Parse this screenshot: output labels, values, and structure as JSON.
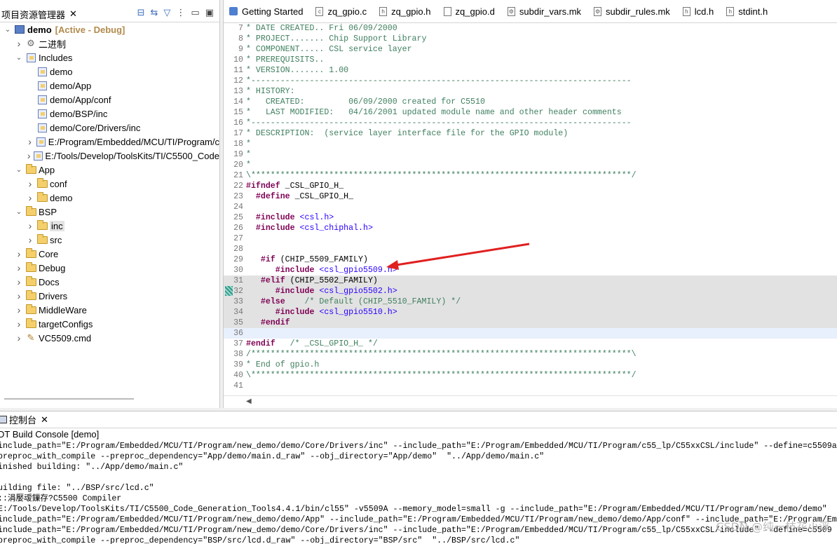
{
  "explorer": {
    "tab_label": "项目资源管理器",
    "close": "✕",
    "tree": [
      {
        "depth": 0,
        "twisty": "open",
        "icon": "project",
        "label": "demo",
        "suffix": "[Active - Debug]",
        "bold": true
      },
      {
        "depth": 1,
        "twisty": "closed",
        "icon": "binaries",
        "label": "二进制"
      },
      {
        "depth": 1,
        "twisty": "open",
        "icon": "includes",
        "label": "Includes"
      },
      {
        "depth": 2,
        "twisty": "none",
        "icon": "incfolder",
        "label": "demo"
      },
      {
        "depth": 2,
        "twisty": "none",
        "icon": "incfolder",
        "label": "demo/App"
      },
      {
        "depth": 2,
        "twisty": "none",
        "icon": "incfolder",
        "label": "demo/App/conf"
      },
      {
        "depth": 2,
        "twisty": "none",
        "icon": "incfolder",
        "label": "demo/BSP/inc"
      },
      {
        "depth": 2,
        "twisty": "none",
        "icon": "incfolder",
        "label": "demo/Core/Drivers/inc"
      },
      {
        "depth": 2,
        "twisty": "closed",
        "icon": "incfolder",
        "label": "E:/Program/Embedded/MCU/TI/Program/c"
      },
      {
        "depth": 2,
        "twisty": "closed",
        "icon": "incfolder",
        "label": "E:/Tools/Develop/ToolsKits/TI/C5500_Code"
      },
      {
        "depth": 1,
        "twisty": "open",
        "icon": "folder",
        "label": "App"
      },
      {
        "depth": 2,
        "twisty": "closed",
        "icon": "folder",
        "label": "conf"
      },
      {
        "depth": 2,
        "twisty": "closed",
        "icon": "folder",
        "label": "demo"
      },
      {
        "depth": 1,
        "twisty": "open",
        "icon": "folder",
        "label": "BSP"
      },
      {
        "depth": 2,
        "twisty": "closed",
        "icon": "folder",
        "label": "inc",
        "selected": true
      },
      {
        "depth": 2,
        "twisty": "closed",
        "icon": "folder",
        "label": "src"
      },
      {
        "depth": 1,
        "twisty": "closed",
        "icon": "folder",
        "label": "Core"
      },
      {
        "depth": 1,
        "twisty": "closed",
        "icon": "folder",
        "label": "Debug"
      },
      {
        "depth": 1,
        "twisty": "closed",
        "icon": "folder",
        "label": "Docs"
      },
      {
        "depth": 1,
        "twisty": "closed",
        "icon": "folder",
        "label": "Drivers"
      },
      {
        "depth": 1,
        "twisty": "closed",
        "icon": "folder",
        "label": "MiddleWare"
      },
      {
        "depth": 1,
        "twisty": "closed",
        "icon": "folder",
        "label": "targetConfigs"
      },
      {
        "depth": 1,
        "twisty": "closed",
        "icon": "cmdfile",
        "label": "VC5509.cmd"
      }
    ]
  },
  "editor": {
    "tabs": [
      {
        "label": "Getting Started",
        "icon": "getting-started"
      },
      {
        "label": "zq_gpio.c",
        "icon": "c-file"
      },
      {
        "label": "zq_gpio.h",
        "icon": "h-file"
      },
      {
        "label": "zq_gpio.d",
        "icon": "d-file"
      },
      {
        "label": "subdir_vars.mk",
        "icon": "mk-file"
      },
      {
        "label": "subdir_rules.mk",
        "icon": "mk-file"
      },
      {
        "label": "lcd.h",
        "icon": "h-file"
      },
      {
        "label": "stdint.h",
        "icon": "h-file"
      }
    ],
    "lines": [
      {
        "n": "7",
        "segs": [
          [
            "cm",
            "* DATE CREATED.. Fri 06/09/2000"
          ]
        ]
      },
      {
        "n": "8",
        "segs": [
          [
            "cm",
            "* PROJECT....... Chip Support Library"
          ]
        ]
      },
      {
        "n": "9",
        "segs": [
          [
            "cm",
            "* COMPONENT..... CSL service layer"
          ]
        ]
      },
      {
        "n": "10",
        "segs": [
          [
            "cm",
            "* PREREQUISITS.."
          ]
        ]
      },
      {
        "n": "11",
        "segs": [
          [
            "cm",
            "* VERSION....... 1.00"
          ]
        ]
      },
      {
        "n": "12",
        "segs": [
          [
            "cm",
            "*------------------------------------------------------------------------------"
          ]
        ]
      },
      {
        "n": "13",
        "segs": [
          [
            "cm",
            "* HISTORY:"
          ]
        ]
      },
      {
        "n": "14",
        "segs": [
          [
            "cm",
            "*   CREATED:         06/09/2000 created for C5510"
          ]
        ]
      },
      {
        "n": "15",
        "segs": [
          [
            "cm",
            "*   LAST MODIFIED:   04/16/2001 updated module name and other header comments"
          ]
        ]
      },
      {
        "n": "16",
        "segs": [
          [
            "cm",
            "*------------------------------------------------------------------------------"
          ]
        ]
      },
      {
        "n": "17",
        "segs": [
          [
            "cm",
            "* DESCRIPTION:  (service layer interface file for the GPIO module)"
          ]
        ]
      },
      {
        "n": "18",
        "segs": [
          [
            "cm",
            "*"
          ]
        ]
      },
      {
        "n": "19",
        "segs": [
          [
            "cm",
            "*"
          ]
        ]
      },
      {
        "n": "20",
        "segs": [
          [
            "cm",
            "*"
          ]
        ]
      },
      {
        "n": "21",
        "segs": [
          [
            "cm",
            "\\******************************************************************************/"
          ]
        ]
      },
      {
        "n": "22",
        "segs": [
          [
            "kw",
            "#ifndef"
          ],
          [
            "plain",
            " _CSL_GPIO_H_"
          ]
        ]
      },
      {
        "n": "23",
        "segs": [
          [
            "kw",
            "  #define"
          ],
          [
            "plain",
            " _CSL_GPIO_H_"
          ]
        ]
      },
      {
        "n": "24",
        "segs": [
          [
            "plain",
            ""
          ]
        ]
      },
      {
        "n": "25",
        "segs": [
          [
            "kw",
            "  #include"
          ],
          [
            "plain",
            " "
          ],
          [
            "st",
            "<csl.h>"
          ]
        ]
      },
      {
        "n": "26",
        "segs": [
          [
            "kw",
            "  #include"
          ],
          [
            "plain",
            " "
          ],
          [
            "st",
            "<csl_chiphal.h>"
          ]
        ]
      },
      {
        "n": "27",
        "segs": [
          [
            "plain",
            ""
          ]
        ]
      },
      {
        "n": "28",
        "segs": [
          [
            "plain",
            ""
          ]
        ]
      },
      {
        "n": "29",
        "segs": [
          [
            "kw",
            "   #if"
          ],
          [
            "plain",
            " (CHIP_5509_FAMILY)"
          ]
        ]
      },
      {
        "n": "30",
        "segs": [
          [
            "kw",
            "      #include"
          ],
          [
            "plain",
            " "
          ],
          [
            "st",
            "<csl_gpio5509.h>"
          ]
        ]
      },
      {
        "n": "31",
        "hl": true,
        "segs": [
          [
            "kw",
            "   #elif"
          ],
          [
            "plain",
            " (CHIP_5502_FAMILY)"
          ]
        ]
      },
      {
        "n": "32",
        "hl": true,
        "segs": [
          [
            "kw",
            "      #include"
          ],
          [
            "plain",
            " "
          ],
          [
            "st",
            "<csl_gpio5502.h>"
          ]
        ]
      },
      {
        "n": "33",
        "hl": true,
        "segs": [
          [
            "kw",
            "   #else"
          ],
          [
            "plain",
            "    "
          ],
          [
            "cm",
            "/* Default (CHIP_5510_FAMILY) */"
          ]
        ]
      },
      {
        "n": "34",
        "hl": true,
        "segs": [
          [
            "kw",
            "      #include"
          ],
          [
            "plain",
            " "
          ],
          [
            "st",
            "<csl_gpio5510.h>"
          ]
        ]
      },
      {
        "n": "35",
        "hl": true,
        "segs": [
          [
            "kw",
            "   #endif"
          ]
        ]
      },
      {
        "n": "36",
        "cur": true,
        "segs": [
          [
            "plain",
            ""
          ]
        ]
      },
      {
        "n": "37",
        "segs": [
          [
            "kw",
            "#endif"
          ],
          [
            "plain",
            "   "
          ],
          [
            "cm",
            "/* _CSL_GPIO_H_ */"
          ]
        ]
      },
      {
        "n": "38",
        "segs": [
          [
            "cm",
            "/******************************************************************************\\"
          ]
        ]
      },
      {
        "n": "39",
        "segs": [
          [
            "cm",
            "* End of gpio.h"
          ]
        ]
      },
      {
        "n": "40",
        "segs": [
          [
            "cm",
            "\\******************************************************************************/"
          ]
        ]
      },
      {
        "n": "41",
        "segs": [
          [
            "plain",
            ""
          ]
        ]
      }
    ]
  },
  "console": {
    "tab_label": "控制台",
    "close": "✕",
    "title": "DT Build Console [demo]",
    "lines": [
      "include_path=\"E:/Program/Embedded/MCU/TI/Program/new_demo/demo/Core/Drivers/inc\" --include_path=\"E:/Program/Embedded/MCU/TI/Program/c55_lp/C55xxCSL/include\" --define=c5509a",
      "preproc_with_compile --preproc_dependency=\"App/demo/main.d_raw\" --obj_directory=\"App/demo\"  \"../App/demo/main.c\"",
      "inished building: \"../App/demo/main.c\"",
      "",
      "uilding file: \"../BSP/src/lcd.c\"",
      "::涓嬮叆鏁存?C5500 Compiler",
      "E:/Tools/Develop/ToolsKits/TI/C5500_Code_Generation_Tools4.4.1/bin/cl55\" -v5509A --memory_model=small -g --include_path=\"E:/Program/Embedded/MCU/TI/Program/new_demo/demo\"",
      "include_path=\"E:/Program/Embedded/MCU/TI/Program/new_demo/demo/App\" --include_path=\"E:/Program/Embedded/MCU/TI/Program/new_demo/demo/App/conf\" --include_path=\"E:/Program/Em",
      "include_path=\"E:/Program/Embedded/MCU/TI/Program/new_demo/demo/Core/Drivers/inc\" --include_path=\"E:/Program/Embedded/MCU/TI/Program/c55_lp/C55xxCSL/include\" --define=c5509",
      "preproc_with_compile --preproc_dependency=\"BSP/src/lcd.d_raw\" --obj_directory=\"BSP/src\"  \"../BSP/src/lcd.c\""
    ],
    "watermark": "CSDN @纯一枝花小浮"
  },
  "colors": {
    "comment": "#3f7f5f",
    "keyword": "#7f0055",
    "string": "#2a00ff",
    "highlight": "#e2e2e2",
    "arrow": "#e02020"
  }
}
